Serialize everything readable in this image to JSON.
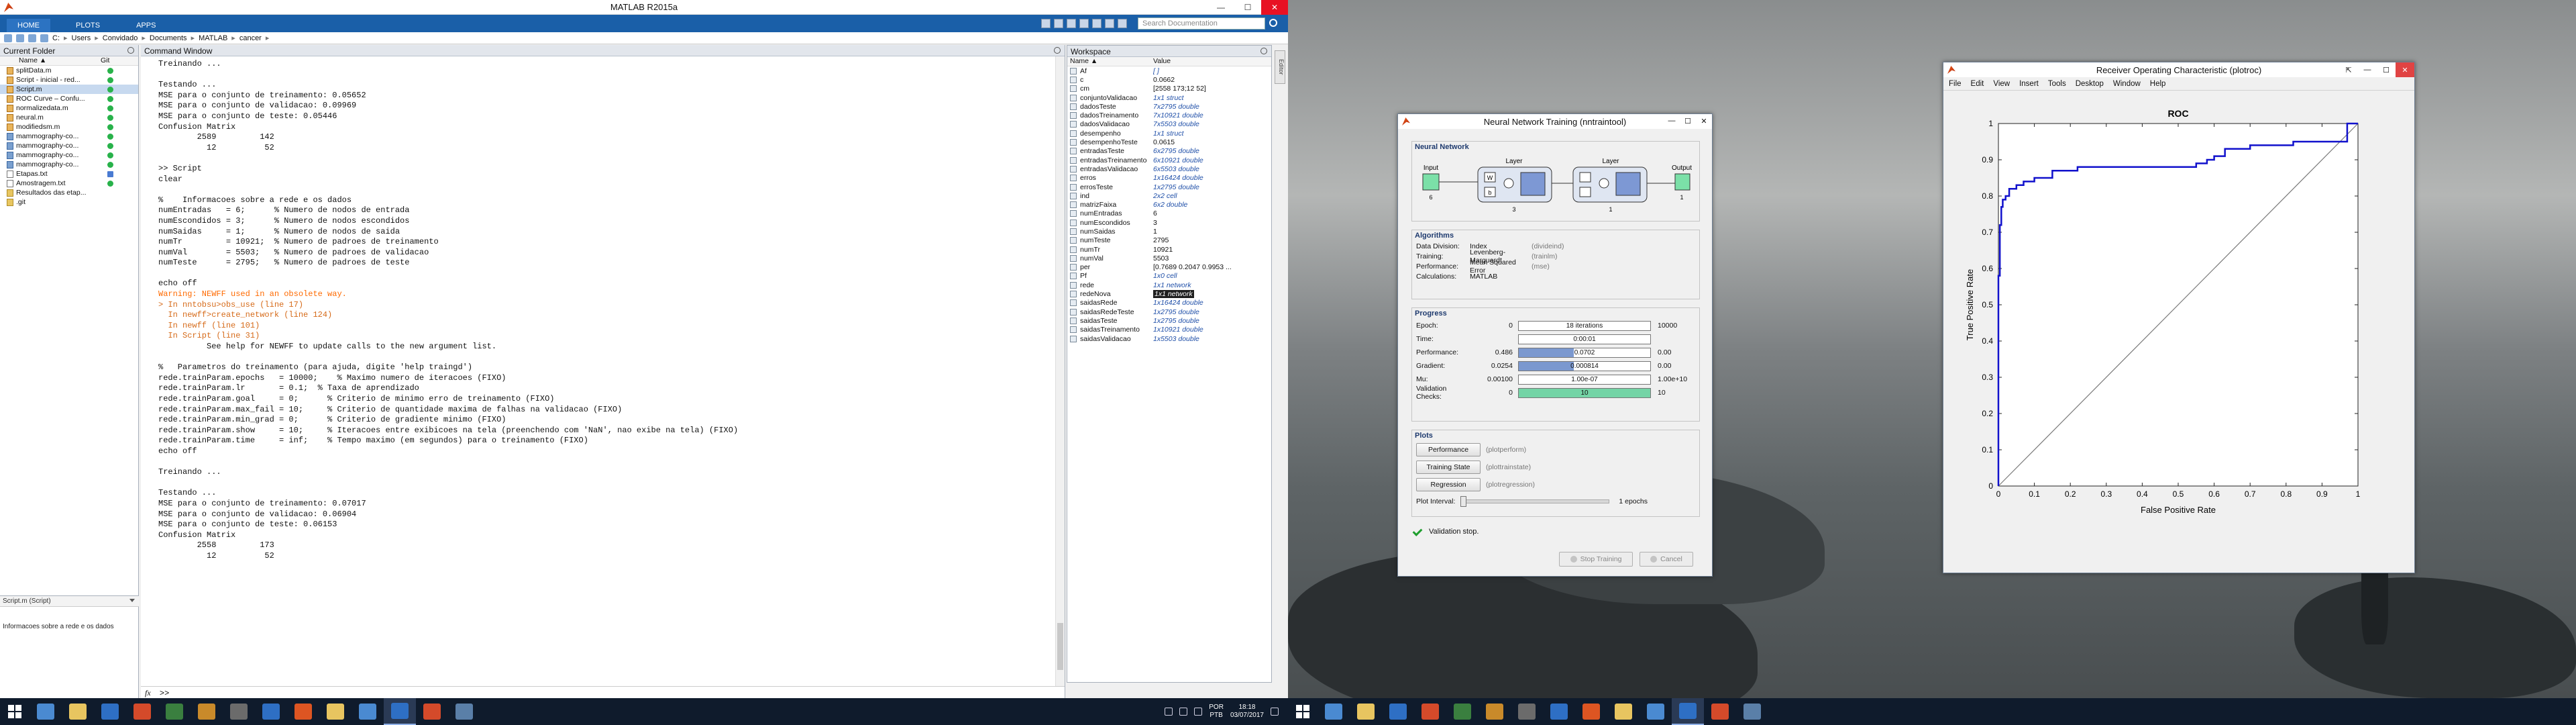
{
  "matlab": {
    "title": "MATLAB R2015a",
    "tabs": [
      "HOME",
      "PLOTS",
      "APPS"
    ],
    "search_placeholder": "Search Documentation",
    "breadcrumb": [
      "C:",
      "Users",
      "Convidado",
      "Documents",
      "MATLAB",
      "cancer"
    ],
    "current_folder": {
      "title": "Current Folder",
      "col_name": "Name ▲",
      "col_git": "Git",
      "files": [
        {
          "name": "splitData.m",
          "type": "m",
          "git": "green"
        },
        {
          "name": "Script - inicial - red...",
          "type": "m",
          "git": "green"
        },
        {
          "name": "Script.m",
          "type": "m",
          "git": "green",
          "selected": true
        },
        {
          "name": "ROC Curve – Confu...",
          "type": "m",
          "git": "green"
        },
        {
          "name": "normalizedata.m",
          "type": "m",
          "git": "green"
        },
        {
          "name": "neural.m",
          "type": "m",
          "git": "green"
        },
        {
          "name": "modifiedsm.m",
          "type": "m",
          "git": "green"
        },
        {
          "name": "mammography-co...",
          "type": "mat",
          "git": "green"
        },
        {
          "name": "mammography-co...",
          "type": "mat",
          "git": "green"
        },
        {
          "name": "mammography-co...",
          "type": "mat",
          "git": "green"
        },
        {
          "name": "mammography-co...",
          "type": "mat",
          "git": "green"
        },
        {
          "name": "Etapas.txt",
          "type": "txt",
          "git": "blue"
        },
        {
          "name": "Amostragem.txt",
          "type": "txt",
          "git": "green"
        },
        {
          "name": "Resultados das etap...",
          "type": "folder",
          "git": ""
        },
        {
          "name": ".git",
          "type": "folder",
          "git": ""
        }
      ],
      "details_file": "Script.m (Script)",
      "details_text": "Informacoes sobre a rede e os dados"
    },
    "command_window": {
      "title": "Command Window",
      "lines": [
        {
          "t": "Treinando ...",
          "s": ""
        },
        {
          "t": "",
          "s": ""
        },
        {
          "t": "Testando ...",
          "s": ""
        },
        {
          "t": "MSE para o conjunto de treinamento: 0.05652",
          "s": ""
        },
        {
          "t": "MSE para o conjunto de validacao: 0.09969",
          "s": ""
        },
        {
          "t": "MSE para o conjunto de teste: 0.05446",
          "s": ""
        },
        {
          "t": "Confusion Matrix",
          "s": ""
        },
        {
          "t": "        2589         142",
          "s": ""
        },
        {
          "t": "          12          52",
          "s": ""
        },
        {
          "t": "",
          "s": ""
        },
        {
          "t": ">> Script",
          "s": ""
        },
        {
          "t": "clear",
          "s": ""
        },
        {
          "t": "",
          "s": ""
        },
        {
          "t": "%    Informacoes sobre a rede e os dados",
          "s": ""
        },
        {
          "t": "numEntradas   = 6;      % Numero de nodos de entrada",
          "s": ""
        },
        {
          "t": "numEscondidos = 3;      % Numero de nodos escondidos",
          "s": ""
        },
        {
          "t": "numSaidas     = 1;      % Numero de nodos de saida",
          "s": ""
        },
        {
          "t": "numTr         = 10921;  % Numero de padroes de treinamento",
          "s": ""
        },
        {
          "t": "numVal        = 5503;   % Numero de padroes de validacao",
          "s": ""
        },
        {
          "t": "numTeste      = 2795;   % Numero de padroes de teste",
          "s": ""
        },
        {
          "t": "",
          "s": ""
        },
        {
          "t": "echo off",
          "s": ""
        },
        {
          "t": "Warning: NEWFF used in an obsolete way.",
          "s": "warn"
        },
        {
          "t": "> In nntobsu>obs_use (line 17)",
          "s": "link"
        },
        {
          "t": "  In newff>create_network (line 124)",
          "s": "link"
        },
        {
          "t": "  In newff (line 101)",
          "s": "link"
        },
        {
          "t": "  In Script (line 31)",
          "s": "link"
        },
        {
          "t": "          See help for NEWFF to update calls to the new argument list.",
          "s": ""
        },
        {
          "t": "",
          "s": ""
        },
        {
          "t": "%   Parametros do treinamento (para ajuda, digite 'help traingd')",
          "s": ""
        },
        {
          "t": "rede.trainParam.epochs   = 10000;    % Maximo numero de iteracoes (FIXO)",
          "s": ""
        },
        {
          "t": "rede.trainParam.lr       = 0.1;  % Taxa de aprendizado",
          "s": ""
        },
        {
          "t": "rede.trainParam.goal     = 0;      % Criterio de minimo erro de treinamento (FIXO)",
          "s": ""
        },
        {
          "t": "rede.trainParam.max_fail = 10;     % Criterio de quantidade maxima de falhas na validacao (FIXO)",
          "s": ""
        },
        {
          "t": "rede.trainParam.min_grad = 0;      % Criterio de gradiente minimo (FIXO)",
          "s": ""
        },
        {
          "t": "rede.trainParam.show     = 10;     % Iteracoes entre exibicoes na tela (preenchendo com 'NaN', nao exibe na tela) (FIXO)",
          "s": ""
        },
        {
          "t": "rede.trainParam.time     = inf;    % Tempo maximo (em segundos) para o treinamento (FIXO)",
          "s": ""
        },
        {
          "t": "echo off",
          "s": ""
        },
        {
          "t": "",
          "s": ""
        },
        {
          "t": "Treinando ...",
          "s": ""
        },
        {
          "t": "",
          "s": ""
        },
        {
          "t": "Testando ...",
          "s": ""
        },
        {
          "t": "MSE para o conjunto de treinamento: 0.07017",
          "s": ""
        },
        {
          "t": "MSE para o conjunto de validacao: 0.06904",
          "s": ""
        },
        {
          "t": "MSE para o conjunto de teste: 0.06153",
          "s": ""
        },
        {
          "t": "Confusion Matrix",
          "s": ""
        },
        {
          "t": "        2558         173",
          "s": ""
        },
        {
          "t": "          12          52",
          "s": ""
        }
      ],
      "prompt": ">>",
      "fx": "fx"
    },
    "workspace": {
      "title": "Workspace",
      "col_name": "Name ▲",
      "col_value": "Value",
      "vars": [
        {
          "n": "Af",
          "v": "[ ]",
          "blue": true
        },
        {
          "n": "c",
          "v": "0.0662",
          "blue": false
        },
        {
          "n": "cm",
          "v": "[2558 173;12 52]",
          "blue": false
        },
        {
          "n": "conjuntoValidacao",
          "v": "1x1 struct",
          "blue": true
        },
        {
          "n": "dadosTeste",
          "v": "7x2795 double",
          "blue": true
        },
        {
          "n": "dadosTreinamento",
          "v": "7x10921 double",
          "blue": true
        },
        {
          "n": "dadosValidacao",
          "v": "7x5503 double",
          "blue": true
        },
        {
          "n": "desempenho",
          "v": "1x1 struct",
          "blue": true
        },
        {
          "n": "desempenhoTeste",
          "v": "0.0615",
          "blue": false
        },
        {
          "n": "entradasTeste",
          "v": "6x2795 double",
          "blue": true
        },
        {
          "n": "entradasTreinamento",
          "v": "6x10921 double",
          "blue": true
        },
        {
          "n": "entradasValidacao",
          "v": "6x5503 double",
          "blue": true
        },
        {
          "n": "erros",
          "v": "1x16424 double",
          "blue": true
        },
        {
          "n": "errosTeste",
          "v": "1x2795 double",
          "blue": true
        },
        {
          "n": "ind",
          "v": "2x2 cell",
          "blue": true
        },
        {
          "n": "matrizFaixa",
          "v": "6x2 double",
          "blue": true
        },
        {
          "n": "numEntradas",
          "v": "6",
          "blue": false
        },
        {
          "n": "numEscondidos",
          "v": "3",
          "blue": false
        },
        {
          "n": "numSaidas",
          "v": "1",
          "blue": false
        },
        {
          "n": "numTeste",
          "v": "2795",
          "blue": false
        },
        {
          "n": "numTr",
          "v": "10921",
          "blue": false
        },
        {
          "n": "numVal",
          "v": "5503",
          "blue": false
        },
        {
          "n": "per",
          "v": "[0.7689 0.2047 0.9953 ...",
          "blue": false
        },
        {
          "n": "Pf",
          "v": "1x0 cell",
          "blue": true
        },
        {
          "n": "rede",
          "v": "1x1 network",
          "blue": true
        },
        {
          "n": "redeNova",
          "v": "1x1 network",
          "blue": true,
          "selected": true
        },
        {
          "n": "saidasRede",
          "v": "1x16424 double",
          "blue": true
        },
        {
          "n": "saidasRedeTeste",
          "v": "1x2795 double",
          "blue": true
        },
        {
          "n": "saidasTeste",
          "v": "1x2795 double",
          "blue": true
        },
        {
          "n": "saidasTreinamento",
          "v": "1x10921 double",
          "blue": true
        },
        {
          "n": "saidasValidacao",
          "v": "1x5503 double",
          "blue": true
        }
      ]
    },
    "side_tab": "Editor"
  },
  "nntraintool": {
    "title": "Neural Network Training (nntraintool)",
    "network_section": "Neural Network",
    "input_label": "Input",
    "input_size": "6",
    "layer1_label": "Layer",
    "layer1_size": "3",
    "layer2_label": "Layer",
    "layer2_size": "1",
    "output_label": "Output",
    "output_size": "1",
    "w_label": "W",
    "b_label": "b",
    "algorithms_section": "Algorithms",
    "algorithms": [
      {
        "k": "Data Division:",
        "v": "Index",
        "h": "(divideind)"
      },
      {
        "k": "Training:",
        "v": "Levenberg-Marquardt",
        "h": "(trainlm)"
      },
      {
        "k": "Performance:",
        "v": "Mean Squared Error",
        "h": "(mse)"
      },
      {
        "k": "Calculations:",
        "v": "MATLAB",
        "h": ""
      }
    ],
    "progress_section": "Progress",
    "progress": [
      {
        "k": "Epoch:",
        "min": "0",
        "text": "18 iterations",
        "fill": 0.0,
        "max": "10000",
        "green": false
      },
      {
        "k": "Time:",
        "min": "",
        "text": "0:00:01",
        "fill": 0.0,
        "max": "",
        "green": false
      },
      {
        "k": "Performance:",
        "min": "0.486",
        "text": "0.0702",
        "fill": 0.42,
        "max": "0.00",
        "green": false
      },
      {
        "k": "Gradient:",
        "min": "0.0254",
        "text": "0.000814",
        "fill": 0.42,
        "max": "0.00",
        "green": false
      },
      {
        "k": "Mu:",
        "min": "0.00100",
        "text": "1.00e-07",
        "fill": 0.0,
        "max": "1.00e+10",
        "green": false
      },
      {
        "k": "Validation Checks:",
        "min": "0",
        "text": "10",
        "fill": 1.0,
        "max": "10",
        "green": true
      }
    ],
    "plots_section": "Plots",
    "plots": [
      {
        "label": "Performance",
        "h": "(plotperform)"
      },
      {
        "label": "Training State",
        "h": "(plottrainstate)"
      },
      {
        "label": "Regression",
        "h": "(plotregression)"
      }
    ],
    "plot_interval_label": "Plot Interval:",
    "plot_interval_value": "1 epochs",
    "status": "Validation stop.",
    "stop_button": "Stop Training",
    "cancel_button": "Cancel"
  },
  "roc_window": {
    "title": "Receiver Operating Characteristic (plotroc)",
    "menu": [
      "File",
      "Edit",
      "View",
      "Insert",
      "Tools",
      "Desktop",
      "Window",
      "Help"
    ]
  },
  "chart_data": {
    "type": "line",
    "title": "ROC",
    "xlabel": "False Positive Rate",
    "ylabel": "True Positive Rate",
    "xlim": [
      0,
      1
    ],
    "ylim": [
      0,
      1
    ],
    "xticks": [
      "0",
      "0.1",
      "0.2",
      "0.3",
      "0.4",
      "0.5",
      "0.6",
      "0.7",
      "0.8",
      "0.9",
      "1"
    ],
    "yticks": [
      "0",
      "0.1",
      "0.2",
      "0.3",
      "0.4",
      "0.5",
      "0.6",
      "0.7",
      "0.8",
      "0.9",
      "1"
    ],
    "grid": false,
    "series": [
      {
        "color": "#1111cc",
        "x": [
          0,
          0,
          0.004,
          0.004,
          0.008,
          0.008,
          0.012,
          0.012,
          0.02,
          0.02,
          0.03,
          0.03,
          0.05,
          0.05,
          0.07,
          0.07,
          0.1,
          0.1,
          0.15,
          0.15,
          0.22,
          0.22,
          0.55,
          0.55,
          0.58,
          0.58,
          0.6,
          0.6,
          0.63,
          0.63,
          0.7,
          0.7,
          0.82,
          0.82,
          0.97,
          0.97,
          1
        ],
        "y": [
          0,
          0.58,
          0.58,
          0.72,
          0.72,
          0.77,
          0.77,
          0.79,
          0.79,
          0.8,
          0.8,
          0.82,
          0.82,
          0.83,
          0.83,
          0.84,
          0.84,
          0.85,
          0.85,
          0.87,
          0.87,
          0.88,
          0.88,
          0.89,
          0.89,
          0.9,
          0.9,
          0.91,
          0.91,
          0.93,
          0.93,
          0.94,
          0.94,
          0.95,
          0.95,
          1.0,
          1.0
        ]
      },
      {
        "color": "#7a7a7a",
        "x": [
          0,
          1
        ],
        "y": [
          0,
          1
        ]
      }
    ]
  },
  "taskbar": {
    "lang_top": "POR",
    "lang_bottom": "PTB",
    "time": "18:18",
    "date": "03/07/2017",
    "icons": [
      "#4a8ad1",
      "#e8c560",
      "#2e6fc4",
      "#d44a2a",
      "#3a7f3f",
      "#c98a2a",
      "#6b6b6b",
      "#2e6fc4",
      "#dd5522",
      "#e8c560",
      "#4a8ad1",
      "#2e6fc4",
      "#d44a2a",
      "#5a7fa8"
    ]
  }
}
